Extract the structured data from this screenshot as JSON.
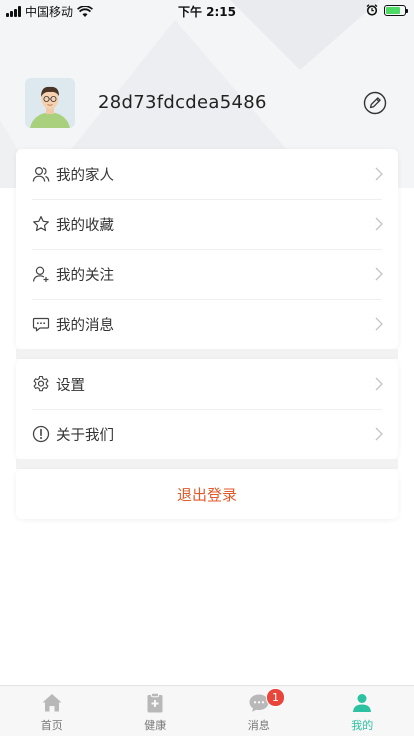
{
  "status_bar": {
    "carrier": "中国移动",
    "time": "下午 2:15"
  },
  "profile": {
    "username": "28d73fdcdea5486"
  },
  "menu_group_1": [
    {
      "label": "我的家人",
      "icon": "family-icon"
    },
    {
      "label": "我的收藏",
      "icon": "star-icon"
    },
    {
      "label": "我的关注",
      "icon": "follow-user-icon"
    },
    {
      "label": "我的消息",
      "icon": "message-icon"
    }
  ],
  "menu_group_2": [
    {
      "label": "设置",
      "icon": "gear-icon"
    },
    {
      "label": "关于我们",
      "icon": "info-icon"
    }
  ],
  "logout": {
    "label": "退出登录"
  },
  "tab_bar": {
    "tabs": [
      {
        "label": "首页",
        "icon": "home-icon",
        "active": false
      },
      {
        "label": "健康",
        "icon": "health-icon",
        "active": false
      },
      {
        "label": "消息",
        "icon": "chat-icon",
        "active": false,
        "badge": "1"
      },
      {
        "label": "我的",
        "icon": "profile-icon",
        "active": true
      }
    ]
  },
  "colors": {
    "accent": "#2cc1a0",
    "logout": "#e15a2b",
    "badge": "#e9453a"
  }
}
